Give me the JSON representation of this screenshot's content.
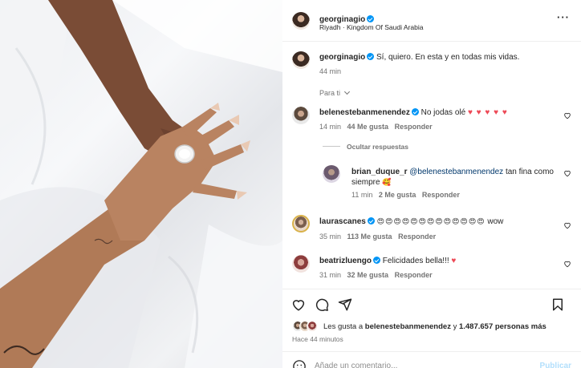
{
  "post": {
    "author": "georginagio",
    "location": "Riyadh · Kingdom Of Saudi Arabia",
    "more_label": "···",
    "caption": "Sí, quiero. En esta y en todas mis vidas.",
    "caption_time": "44 min"
  },
  "filter": {
    "label": "Para ti",
    "chevron": "⌄"
  },
  "comments": [
    {
      "user": "belenestebanmenendez",
      "verified": true,
      "text": "No jodas olé",
      "emoji": "♥ ♥ ♥ ♥ ♥",
      "time": "14 min",
      "likes": "44 Me gusta",
      "reply": "Responder"
    },
    {
      "user": "laurascanes",
      "verified": true,
      "text": "",
      "emoji": "😍😍😍😍😍😍😍😍😍😍😍😍😍",
      "trailing": "wow",
      "time": "35 min",
      "likes": "113 Me gusta",
      "reply": "Responder"
    },
    {
      "user": "beatrizluengo",
      "verified": true,
      "text": "Felicidades bella!!!",
      "emoji": "♥",
      "time": "31 min",
      "likes": "32 Me gusta",
      "reply": "Responder"
    }
  ],
  "thread": {
    "hide_label": "Ocultar respuestas",
    "reply": {
      "user": "brian_duque_r",
      "mention": "@belenestebanmenendez",
      "text": "tan fina como siempre",
      "emoji": "🥰",
      "time": "11 min",
      "likes": "2 Me gusta",
      "reply": "Responder"
    }
  },
  "actions": {
    "liked_by_prefix": "Les gusta a",
    "liked_by_user": "belenestebanmenendez",
    "liked_by_suffix": "y",
    "liked_count": "1.487.657 personas más",
    "timestamp": "Hace 44 minutos"
  },
  "composer": {
    "placeholder": "Añade un comentario...",
    "publish": "Publicar"
  },
  "colors": {
    "verified": "#0095f6",
    "heart": "#ed4956",
    "link": "#0095f6"
  }
}
